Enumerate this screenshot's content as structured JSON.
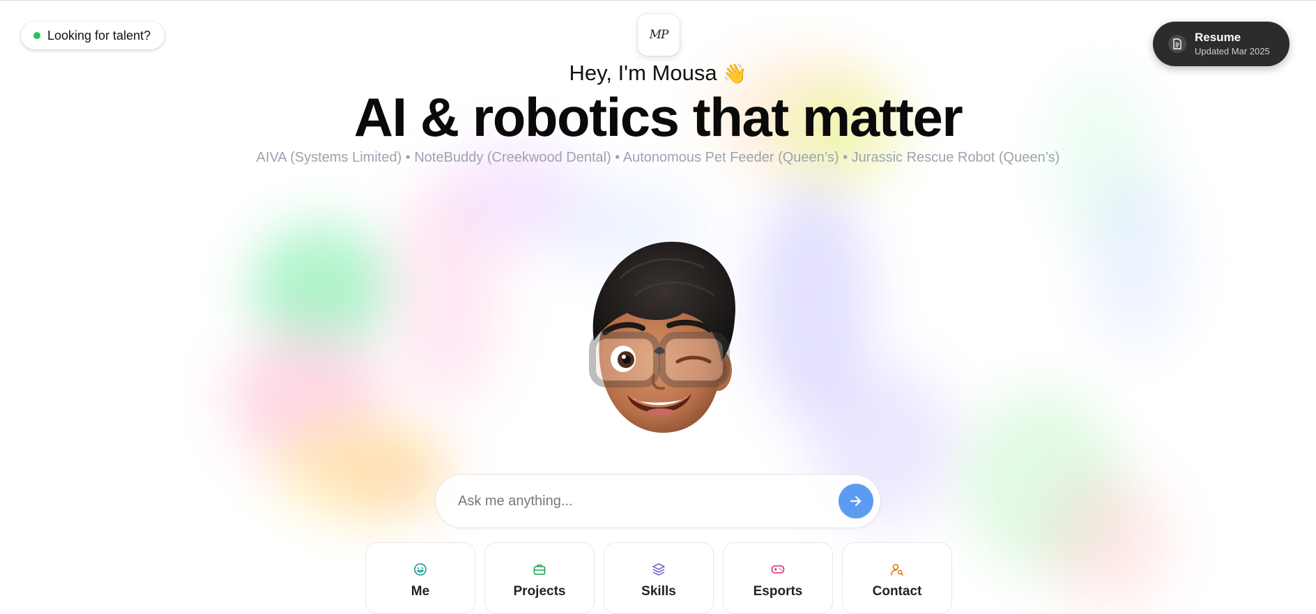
{
  "status": {
    "label": "Looking for talent?",
    "dot_color": "#22c55e"
  },
  "logo": {
    "monogram": "MP"
  },
  "resume": {
    "title": "Resume",
    "subtitle": "Updated Mar 2025",
    "icon": "document-icon"
  },
  "hero": {
    "greeting": "Hey, I'm Mousa",
    "wave_emoji": "👋",
    "headline": "AI & robotics that matter",
    "projects_line": "AIVA (Systems Limited) • NoteBuddy (Creekwood Dental) • Autonomous Pet Feeder (Queen’s) • Jurassic Rescue Robot (Queen’s)"
  },
  "avatar": {
    "icon": "memoji-avatar-winking"
  },
  "ask": {
    "placeholder": "Ask me anything...",
    "value": "",
    "send_color": "#5b9cf0"
  },
  "nav": [
    {
      "label": "Me",
      "icon": "smile-icon",
      "color": "#0f9b8e"
    },
    {
      "label": "Projects",
      "icon": "briefcase-icon",
      "color": "#16a34a"
    },
    {
      "label": "Skills",
      "icon": "layers-icon",
      "color": "#6d4fd6"
    },
    {
      "label": "Esports",
      "icon": "gamepad-icon",
      "color": "#db2777"
    },
    {
      "label": "Contact",
      "icon": "user-search-icon",
      "color": "#d97706"
    }
  ]
}
